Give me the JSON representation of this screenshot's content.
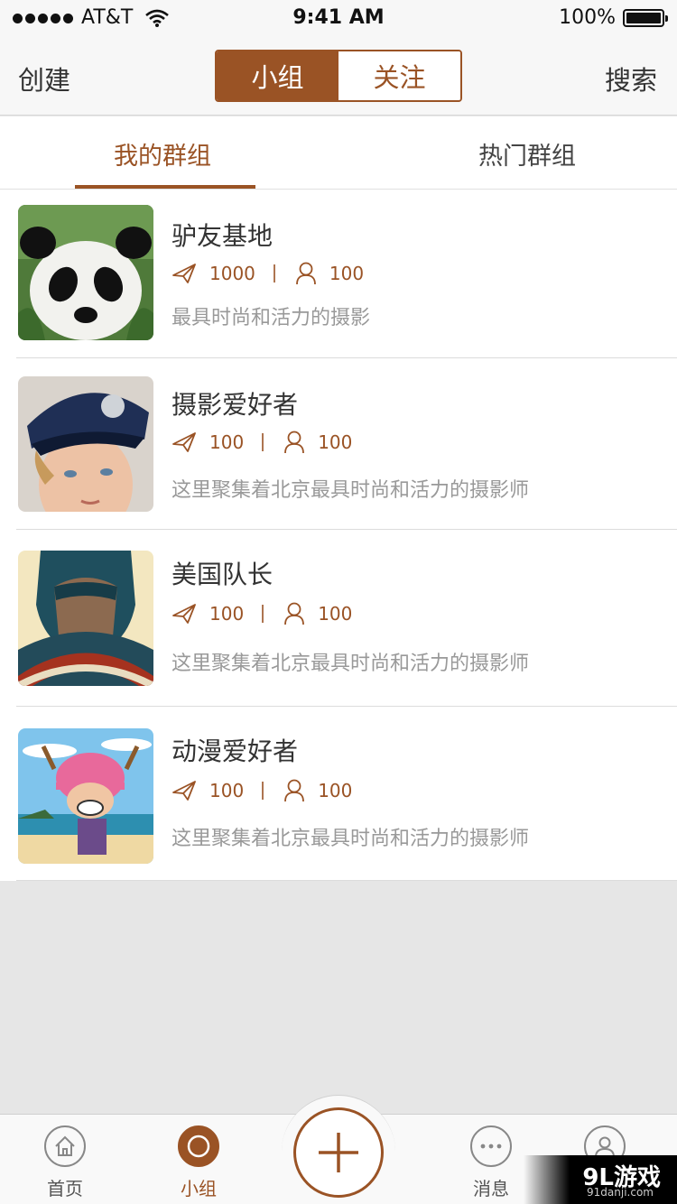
{
  "status_bar": {
    "carrier": "AT&T",
    "time": "9:41 AM",
    "battery": "100%"
  },
  "navbar": {
    "left_button": "创建",
    "right_button": "搜索",
    "segments": [
      {
        "label": "小组",
        "active": true
      },
      {
        "label": "关注",
        "active": false
      }
    ]
  },
  "subtabs": {
    "mine": "我的群组",
    "hot": "热门群组"
  },
  "groups": [
    {
      "title": "驴友基地",
      "posts": "1000",
      "members": "100",
      "desc": "最具时尚和活力的摄影",
      "thumb_icon": "panda-photo"
    },
    {
      "title": "摄影爱好者",
      "posts": "100",
      "members": "100",
      "desc": "这里聚集着北京最具时尚和活力的摄影师",
      "thumb_icon": "boy-cap-photo"
    },
    {
      "title": "美国队长",
      "posts": "100",
      "members": "100",
      "desc": "这里聚集着北京最具时尚和活力的摄影师",
      "thumb_icon": "captain-america-art"
    },
    {
      "title": "动漫爱好者",
      "posts": "100",
      "members": "100",
      "desc": "这里聚集着北京最具时尚和活力的摄影师",
      "thumb_icon": "chopper-cartoon"
    }
  ],
  "tabbar": {
    "home": "首页",
    "groups": "小组",
    "messages": "消息"
  },
  "watermark": {
    "big": "9L游戏",
    "small": "91danji.com"
  },
  "colors": {
    "accent": "#9a5325",
    "background": "#e6e6e6"
  }
}
